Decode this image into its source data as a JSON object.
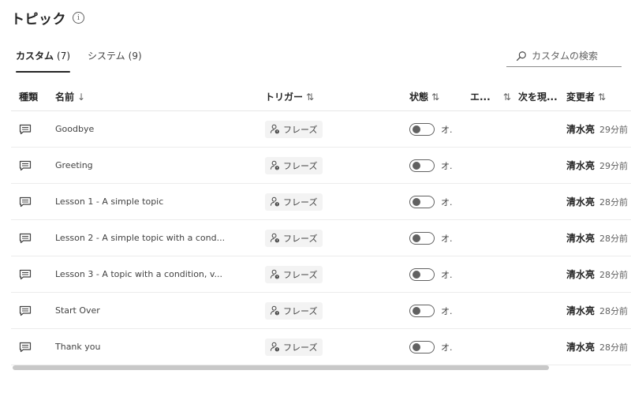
{
  "page": {
    "title": "トピック",
    "info_icon": "info-icon"
  },
  "tabs": [
    {
      "label": "カスタム",
      "count": "(7)",
      "active": true
    },
    {
      "label": "システム",
      "count": "(9)",
      "active": false
    }
  ],
  "search": {
    "placeholder": "カスタムの検索",
    "value": "",
    "icon": "search-icon"
  },
  "table": {
    "columns": [
      {
        "label": "種類",
        "sort_icon": ""
      },
      {
        "label": "名前",
        "sort_icon": "↓"
      },
      {
        "label": "トリガー",
        "sort_icon": "⇅"
      },
      {
        "label": "状態",
        "sort_icon": "⇅"
      },
      {
        "label": "エ...",
        "sort_icon": "⇅"
      },
      {
        "label": "次を現...",
        "sort_icon": ""
      },
      {
        "label": "変更者",
        "sort_icon": "⇅"
      }
    ],
    "rows": [
      {
        "type_icon": "message-icon",
        "name": "Goodbye",
        "trigger": "フレーズ",
        "status": "オ.",
        "editor": "清水亮",
        "modified": "29分前"
      },
      {
        "type_icon": "message-icon",
        "name": "Greeting",
        "trigger": "フレーズ",
        "status": "オ.",
        "editor": "清水亮",
        "modified": "29分前"
      },
      {
        "type_icon": "message-icon",
        "name": "Lesson 1 - A simple topic",
        "trigger": "フレーズ",
        "status": "オ.",
        "editor": "清水亮",
        "modified": "28分前"
      },
      {
        "type_icon": "message-icon",
        "name": "Lesson 2 - A simple topic with a cond...",
        "trigger": "フレーズ",
        "status": "オ.",
        "editor": "清水亮",
        "modified": "28分前"
      },
      {
        "type_icon": "message-icon",
        "name": "Lesson 3 - A topic with a condition, v...",
        "trigger": "フレーズ",
        "status": "オ.",
        "editor": "清水亮",
        "modified": "28分前"
      },
      {
        "type_icon": "message-icon",
        "name": "Start Over",
        "trigger": "フレーズ",
        "status": "オ.",
        "editor": "清水亮",
        "modified": "28分前"
      },
      {
        "type_icon": "message-icon",
        "name": "Thank you",
        "trigger": "フレーズ",
        "status": "オ.",
        "editor": "清水亮",
        "modified": "28分前"
      }
    ]
  },
  "colors": {
    "text": "#242424",
    "muted": "#616161",
    "chip_bg": "#f3f3f3",
    "divider": "#e6e6e6"
  }
}
